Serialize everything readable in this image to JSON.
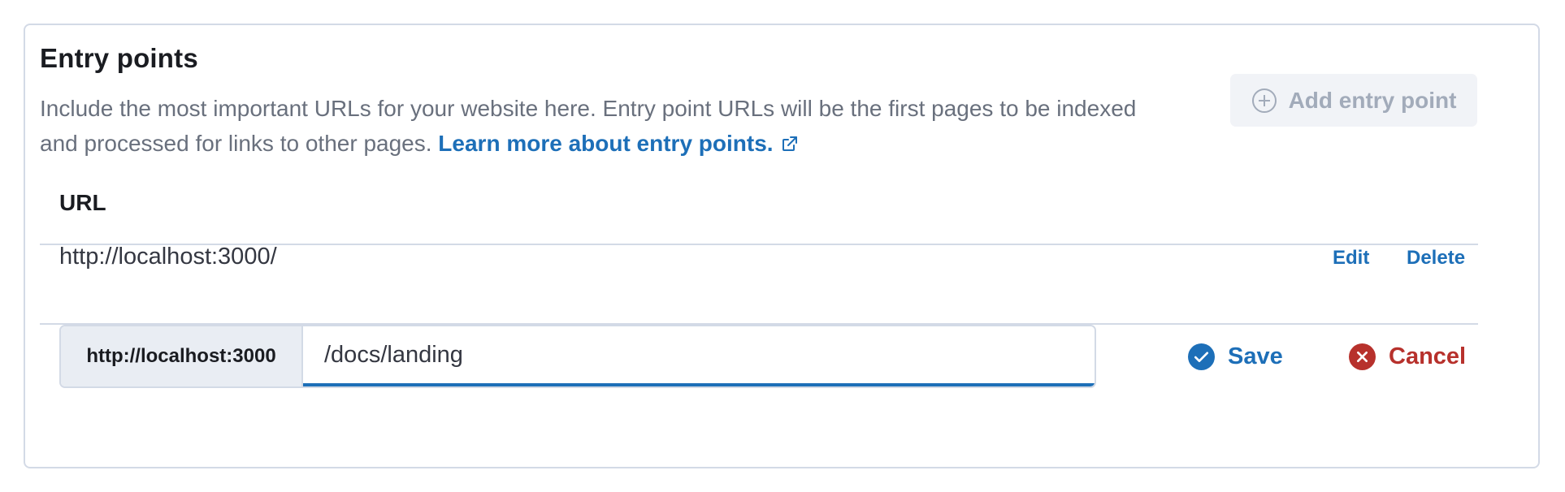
{
  "section": {
    "title": "Entry points",
    "description": "Include the most important URLs for your website here. Entry point URLs will be the first pages to be indexed and processed for links to other pages.",
    "learn_more_link": "Learn more about entry points.",
    "add_button_label": "Add entry point"
  },
  "table": {
    "column_header": "URL",
    "rows": [
      {
        "url": "http://localhost:3000/",
        "edit_label": "Edit",
        "delete_label": "Delete"
      }
    ]
  },
  "editor": {
    "prefix": "http://localhost:3000",
    "value": "/docs/landing",
    "save_label": "Save",
    "cancel_label": "Cancel"
  },
  "colors": {
    "link": "#1d6fb8",
    "danger": "#b7312c",
    "disabled_button_bg": "#f1f3f7",
    "disabled_text": "#a2abba"
  },
  "icons": {
    "add_button": "plus-in-circle-icon",
    "learn_more": "external-link-icon",
    "save": "check-circle-icon",
    "cancel": "cross-circle-icon"
  }
}
